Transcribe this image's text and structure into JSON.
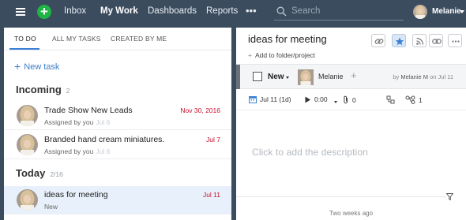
{
  "topbar": {
    "nav": [
      "Inbox",
      "My Work",
      "Dashboards",
      "Reports"
    ],
    "active_nav": "My Work",
    "more": "•••",
    "search_placeholder": "Search",
    "user_name": "Melanie",
    "colors": {
      "bar": "#3c4c5f",
      "add_button": "#1fb545"
    },
    "icons": [
      "hamburger-menu-icon",
      "plus-icon",
      "search-icon",
      "chevron-down-icon"
    ]
  },
  "left": {
    "tabs": [
      "TO DO",
      "ALL MY TASKS",
      "CREATED BY ME"
    ],
    "active_tab": "TO DO",
    "new_task_label": "New task",
    "incoming": {
      "title": "Incoming",
      "count": "2",
      "tasks": [
        {
          "title": "Trade Show New Leads",
          "assigned": "Assigned by you",
          "assigned_date": "Jul 6",
          "due": "Nov 30, 2016"
        },
        {
          "title": "Branded hand cream miniatures.",
          "assigned": "Assigned by you",
          "assigned_date": "Jul 6",
          "due": "Jul 7"
        }
      ]
    },
    "today": {
      "title": "Today",
      "count": "2/16",
      "tasks": [
        {
          "title": "ideas for meeting",
          "status": "New",
          "due": "Jul 11"
        }
      ]
    }
  },
  "detail": {
    "title": "ideas for meeting",
    "add_folder_label": "Add to folder/project",
    "status": "New",
    "assignee": "Melanie",
    "created_prefix": "by",
    "created_by": "Melanie M",
    "created_on": "on Jul 11",
    "date": "Jul 11 (1d)",
    "time_tracked": "0:00",
    "attachments": "0",
    "subtasks": "1",
    "description_placeholder": "Click to add the description",
    "timestamp": "Two weeks ago",
    "icons": [
      "link-icon",
      "star-icon",
      "rss-icon",
      "chain-icon",
      "more-icon",
      "calendar-icon",
      "play-icon",
      "paperclip-icon",
      "dependency-icon",
      "subtask-icon",
      "filter-icon"
    ],
    "colors": {
      "status_strip": "#6b7178",
      "starred_bg": "#d9e7f7",
      "due_red": "#c8102e"
    }
  }
}
